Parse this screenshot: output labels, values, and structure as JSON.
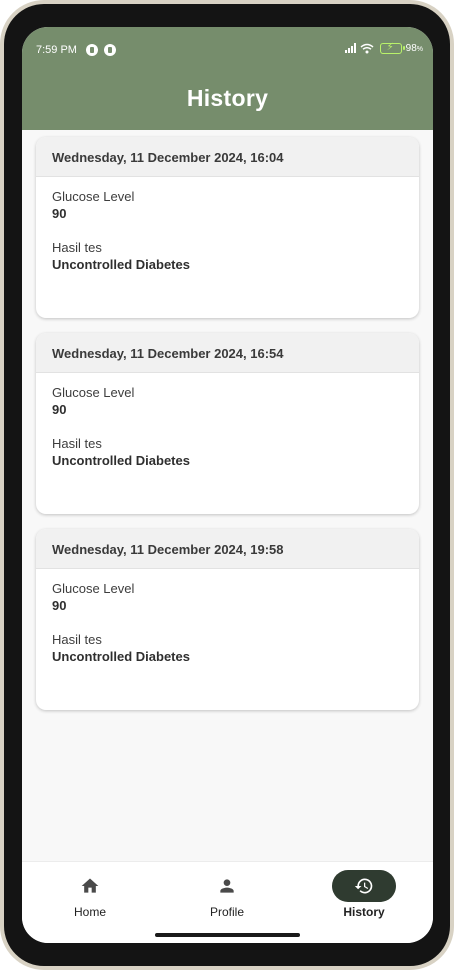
{
  "status_bar": {
    "time": "7:59 PM",
    "battery_percent": "98",
    "battery_unit": "%"
  },
  "header": {
    "title": "History"
  },
  "history": [
    {
      "datetime": "Wednesday, 11 December 2024, 16:04",
      "glucose_label": "Glucose Level",
      "glucose_value": "90",
      "result_label": "Hasil tes",
      "result_value": "Uncontrolled Diabetes"
    },
    {
      "datetime": "Wednesday, 11 December 2024, 16:54",
      "glucose_label": "Glucose Level",
      "glucose_value": "90",
      "result_label": "Hasil tes",
      "result_value": "Uncontrolled Diabetes"
    },
    {
      "datetime": "Wednesday, 11 December 2024, 19:58",
      "glucose_label": "Glucose Level",
      "glucose_value": "90",
      "result_label": "Hasil tes",
      "result_value": "Uncontrolled Diabetes"
    }
  ],
  "bottom_nav": {
    "items": [
      {
        "label": "Home",
        "icon": "home-icon",
        "active": false
      },
      {
        "label": "Profile",
        "icon": "person-icon",
        "active": false
      },
      {
        "label": "History",
        "icon": "history-icon",
        "active": true
      }
    ]
  },
  "colors": {
    "header": "#768d6c",
    "active_nav_pill": "#2f3b30",
    "battery": "#b9f26a"
  }
}
